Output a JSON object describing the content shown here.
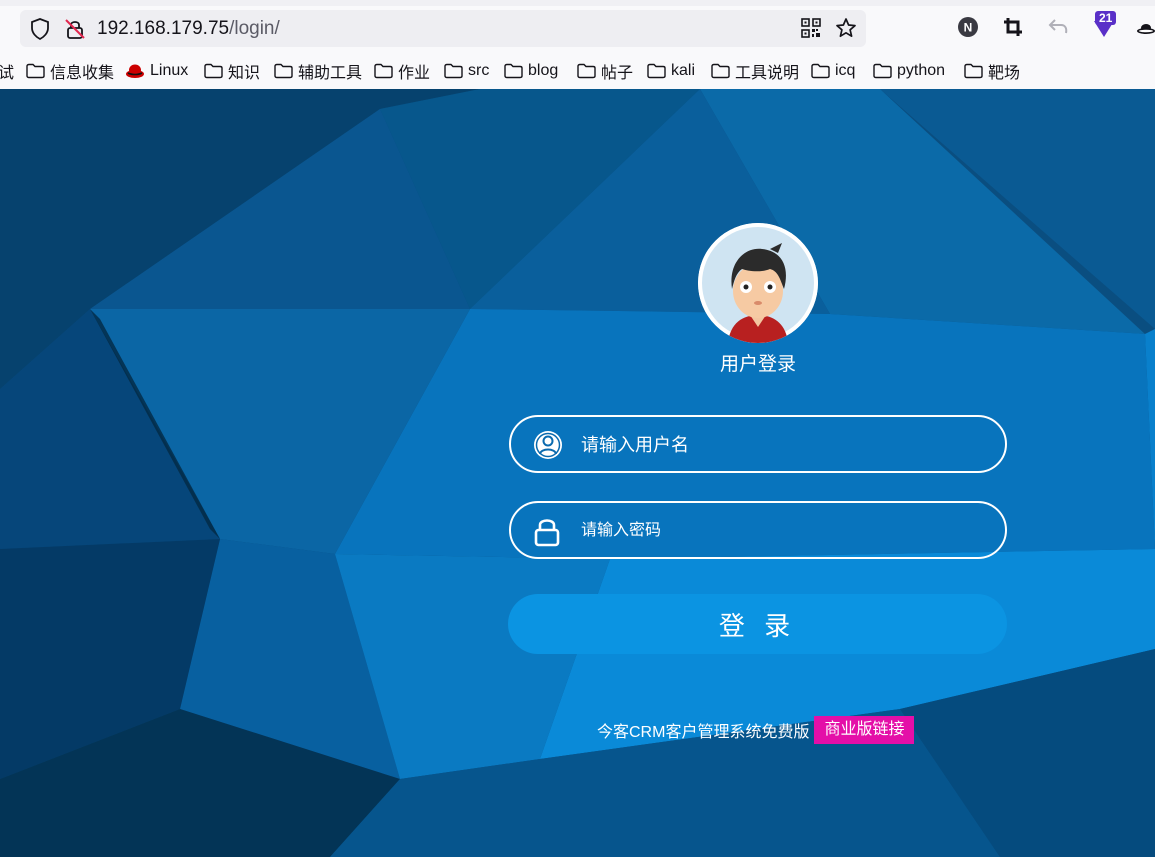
{
  "browser": {
    "url_host": "192.168.179.75",
    "url_path": "/login/",
    "extension_badge": "21",
    "profile_letter": "N"
  },
  "bookmarks": [
    {
      "label": "试",
      "icon": "none"
    },
    {
      "label": "信息收集",
      "icon": "folder-icon"
    },
    {
      "label": "Linux",
      "icon": "redhat-icon"
    },
    {
      "label": "知识",
      "icon": "folder-icon"
    },
    {
      "label": "辅助工具",
      "icon": "folder-icon"
    },
    {
      "label": "作业",
      "icon": "folder-icon"
    },
    {
      "label": "src",
      "icon": "folder-icon"
    },
    {
      "label": "blog",
      "icon": "folder-icon"
    },
    {
      "label": "帖子",
      "icon": "folder-icon"
    },
    {
      "label": "kali",
      "icon": "folder-icon"
    },
    {
      "label": "工具说明",
      "icon": "folder-icon"
    },
    {
      "label": "icq",
      "icon": "folder-icon"
    },
    {
      "label": "python",
      "icon": "folder-icon"
    },
    {
      "label": "靶场",
      "icon": "folder-icon"
    }
  ],
  "login": {
    "title": "用户登录",
    "username_placeholder": "请输入用户名",
    "password_placeholder": "请输入密码",
    "button_label": "登 录",
    "footer_text": "今客CRM客户管理系统免费版",
    "footer_link": "商业版链接"
  },
  "colors": {
    "background": "#0a4e80",
    "button": "#0b94e2",
    "link_badge": "#e40fa8"
  }
}
